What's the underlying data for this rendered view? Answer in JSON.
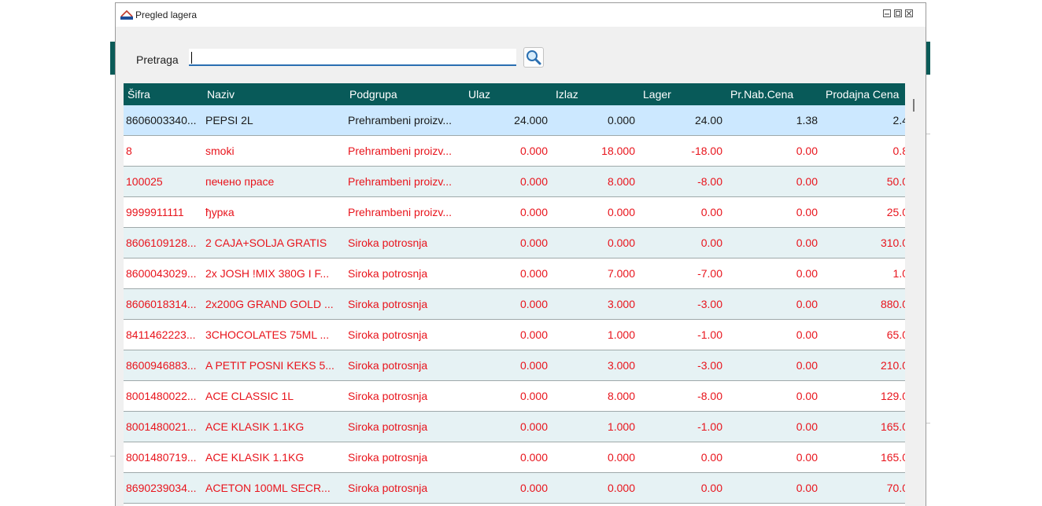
{
  "window": {
    "title": "Pregled lagera",
    "app_icon": "app-logo-icon",
    "controls": [
      "minimize-icon",
      "restore-icon",
      "close-icon"
    ]
  },
  "search": {
    "label": "Pretraga",
    "value": "",
    "button_icon": "magnifier-icon"
  },
  "grid": {
    "columns": [
      "Šifra",
      "Naziv",
      "Podgrupa",
      "Ulaz",
      "Izlaz",
      "Lager",
      "Pr.Nab.Cena",
      "Prodajna Cena"
    ],
    "rows": [
      {
        "sifra": "8606003340...",
        "naziv": "PEPSI 2L",
        "podgrupa": "Prehrambeni proizv...",
        "ulaz": "24.000",
        "izlaz": "0.000",
        "lager": "24.00",
        "prnab": "1.38",
        "prodajna": "2.4"
      },
      {
        "sifra": "8",
        "naziv": "smoki",
        "podgrupa": "Prehrambeni proizv...",
        "ulaz": "0.000",
        "izlaz": "18.000",
        "lager": "-18.00",
        "prnab": "0.00",
        "prodajna": "0.8"
      },
      {
        "sifra": "100025",
        "naziv": "печено прасе",
        "podgrupa": "Prehrambeni proizv...",
        "ulaz": "0.000",
        "izlaz": "8.000",
        "lager": "-8.00",
        "prnab": "0.00",
        "prodajna": "50.0"
      },
      {
        "sifra": "9999911111",
        "naziv": "ђурка",
        "podgrupa": "Prehrambeni proizv...",
        "ulaz": "0.000",
        "izlaz": "0.000",
        "lager": "0.00",
        "prnab": "0.00",
        "prodajna": "25.0"
      },
      {
        "sifra": "8606109128...",
        "naziv": "2 CAJA+SOLJA GRATIS",
        "podgrupa": "Siroka potrosnja",
        "ulaz": "0.000",
        "izlaz": "0.000",
        "lager": "0.00",
        "prnab": "0.00",
        "prodajna": "310.0"
      },
      {
        "sifra": "8600043029...",
        "naziv": "2x JOSH !MIX 380G I F...",
        "podgrupa": "Siroka potrosnja",
        "ulaz": "0.000",
        "izlaz": "7.000",
        "lager": "-7.00",
        "prnab": "0.00",
        "prodajna": "1.0"
      },
      {
        "sifra": "8606018314...",
        "naziv": "2x200G GRAND GOLD ...",
        "podgrupa": "Siroka potrosnja",
        "ulaz": "0.000",
        "izlaz": "3.000",
        "lager": "-3.00",
        "prnab": "0.00",
        "prodajna": "880.0"
      },
      {
        "sifra": "8411462223...",
        "naziv": "3CHOCOLATES 75ML ...",
        "podgrupa": "Siroka potrosnja",
        "ulaz": "0.000",
        "izlaz": "1.000",
        "lager": "-1.00",
        "prnab": "0.00",
        "prodajna": "65.0"
      },
      {
        "sifra": "8600946883...",
        "naziv": "A PETIT POSNI KEKS 5...",
        "podgrupa": "Siroka potrosnja",
        "ulaz": "0.000",
        "izlaz": "3.000",
        "lager": "-3.00",
        "prnab": "0.00",
        "prodajna": "210.0"
      },
      {
        "sifra": "8001480022...",
        "naziv": "ACE CLASSIC 1L",
        "podgrupa": "Siroka potrosnja",
        "ulaz": "0.000",
        "izlaz": "8.000",
        "lager": "-8.00",
        "prnab": "0.00",
        "prodajna": "129.0"
      },
      {
        "sifra": "8001480021...",
        "naziv": "ACE KLASIK 1.1KG",
        "podgrupa": "Siroka potrosnja",
        "ulaz": "0.000",
        "izlaz": "1.000",
        "lager": "-1.00",
        "prnab": "0.00",
        "prodajna": "165.0"
      },
      {
        "sifra": "8001480719...",
        "naziv": "ACE KLASIK 1.1KG",
        "podgrupa": "Siroka potrosnja",
        "ulaz": "0.000",
        "izlaz": "0.000",
        "lager": "0.00",
        "prnab": "0.00",
        "prodajna": "165.0"
      },
      {
        "sifra": "8690239034...",
        "naziv": "ACETON 100ML SECR...",
        "podgrupa": "Siroka potrosnja",
        "ulaz": "0.000",
        "izlaz": "0.000",
        "lager": "0.00",
        "prnab": "0.00",
        "prodajna": "70.0"
      }
    ]
  },
  "colors": {
    "header_bg": "#085a59",
    "header_text": "#ffffff",
    "selected_row_bg": "#cce8ff",
    "selected_row_text": "#1a1a1a",
    "row_text": "#e8141c",
    "row_bg_alt": "#e6f2f4",
    "row_bg": "#ffffff"
  }
}
